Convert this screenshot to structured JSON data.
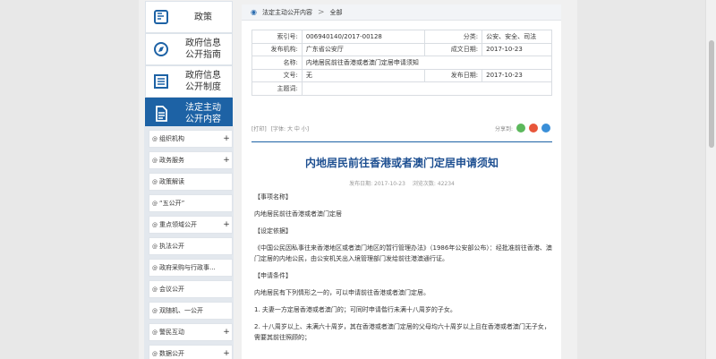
{
  "colors": {
    "accent": "#1d62a5",
    "title": "#1d4f91",
    "wechat": "#5cb85c",
    "weibo": "#e8563a",
    "qq": "#3a8fd8"
  },
  "sidebar": {
    "categories": [
      {
        "label": "政策",
        "icon": "document-icon"
      },
      {
        "label": "政府信息\n公开指南",
        "icon": "compass-icon"
      },
      {
        "label": "政府信息\n公开制度",
        "icon": "list-icon"
      },
      {
        "label": "法定主动\n公开内容",
        "icon": "file-icon",
        "active": true
      }
    ],
    "items": [
      {
        "label": "组织机构",
        "plus": "+"
      },
      {
        "label": "政务服务",
        "plus": "+"
      },
      {
        "label": "政策解读",
        "plus": ""
      },
      {
        "label": "“五公开”",
        "plus": ""
      },
      {
        "label": "重点领域公开",
        "plus": "+"
      },
      {
        "label": "执法公开",
        "plus": ""
      },
      {
        "label": "政府采购与行政事...",
        "plus": ""
      },
      {
        "label": "会议公开",
        "plus": ""
      },
      {
        "label": "双随机、一公开",
        "plus": ""
      },
      {
        "label": "警民互动",
        "plus": "+"
      },
      {
        "label": "数据公开",
        "plus": "+"
      }
    ],
    "item_prefix": "@"
  },
  "breadcrumb": {
    "level1": "法定主动公开内容",
    "separator": ">",
    "level2": "全部"
  },
  "meta": {
    "index_no_label": "索引号:",
    "index_no": "006940140/2017-00128",
    "category_label": "分类:",
    "category": "公安、安全、司法",
    "publisher_label": "发布机构:",
    "publisher": "广东省公安厅",
    "written_date_label": "成文日期:",
    "written_date": "2017-10-23",
    "name_label": "名称:",
    "name": "内地居民前往香港或者澳门定居申请须知",
    "doc_no_label": "文号:",
    "doc_no": "无",
    "publish_date_label": "发布日期:",
    "publish_date": "2017-10-23",
    "keywords_label": "主题词:",
    "keywords": ""
  },
  "tools": {
    "print": "[打印]",
    "font": "[字体: 大 中 小]",
    "share": "分享到:"
  },
  "article": {
    "title": "内地居民前往香港或者澳门定居申请须知",
    "publish_time": "发布日期: 2017-10-23",
    "views": "浏览次数: 42234",
    "paragraphs": [
      "【事项名称】",
      "内地居民前往香港或者澳门定居",
      "【设定依据】",
      "《中国公民因私事往来香港地区或者澳门地区的暂行管理办法》（1986年公安部公布）：经批准前往香港、澳门定居的内地公民，由公安机关出入境管理部门发给前往港澳通行证。",
      "【申请条件】",
      "内地居民有下列情形之一的，可以申请前往香港或者澳门定居。",
      "1. 夫妻一方定居香港或者澳门的；可同时申请偕行未满十八周岁的子女。",
      "2. 十八周岁以上、未满六十周岁，其在香港或者澳门定居的父母均六十周岁以上且在香港或者澳门无子女，需要其前往照顾的；"
    ]
  }
}
